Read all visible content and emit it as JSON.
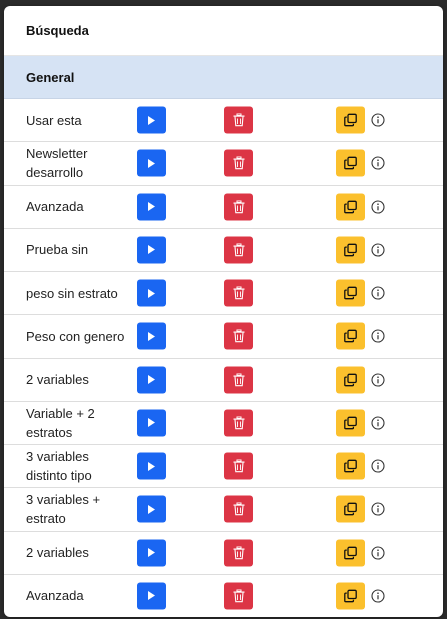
{
  "header": {
    "title": "Búsqueda"
  },
  "section": {
    "title": "General"
  },
  "rows": [
    {
      "label": "Usar esta"
    },
    {
      "label": "Newsletter desarrollo"
    },
    {
      "label": "Avanzada"
    },
    {
      "label": "Prueba sin"
    },
    {
      "label": "peso sin estrato"
    },
    {
      "label": "Peso con genero"
    },
    {
      "label": "2 variables"
    },
    {
      "label": "Variable + 2 estratos"
    },
    {
      "label": "3 variables distinto tipo"
    },
    {
      "label": "3 variables + estrato"
    },
    {
      "label": "2 variables"
    },
    {
      "label": "Avanzada"
    }
  ],
  "icons": {
    "play": "play-icon",
    "delete": "trash-icon",
    "copy": "copy-icon",
    "info": "info-icon"
  },
  "colors": {
    "play": "#1a66f2",
    "delete": "#dc3545",
    "copy": "#fbc02d",
    "section_bg": "#d6e3f4"
  }
}
